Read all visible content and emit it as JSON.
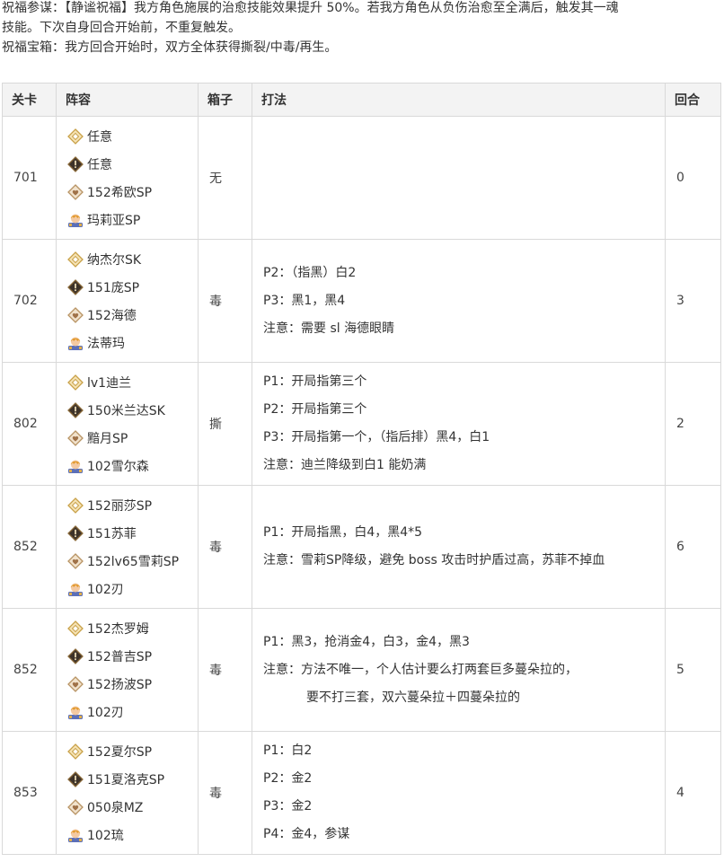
{
  "intro": {
    "line1": "祝福参谋：【静谧祝福】我方角色施展的治愈技能效果提升 50%。若我方角色从负伤治愈至全满后，触发其一魂",
    "line2": "技能。下次自身回合开始前，不重复触发。",
    "line3": "祝福宝箱：我方回合开始时，双方全体获得撕裂/中毒/再生。"
  },
  "headers": {
    "stage": "关卡",
    "lineup": "阵容",
    "box": "箱子",
    "strategy": "打法",
    "rounds": "回合"
  },
  "icons": {
    "slot1": "gold-diamond-icon",
    "slot2": "dark-diamond-icon",
    "slot3": "heart-diamond-icon",
    "slot4": "character-icon"
  },
  "rows": [
    {
      "stage": "701",
      "units": [
        "任意",
        "任意",
        "152希欧SP",
        "玛莉亚SP"
      ],
      "box": "无",
      "notes": [],
      "rounds": "0"
    },
    {
      "stage": "702",
      "units": [
        "纳杰尔SK",
        "151庞SP",
        "152海德",
        "法蒂玛"
      ],
      "box": "毒",
      "notes": [
        "P2：（指黑）白2",
        "P3：黑1，黑4",
        "注意：需要 sl 海德眼睛"
      ],
      "rounds": "3"
    },
    {
      "stage": "802",
      "units": [
        "lv1迪兰",
        "150米兰达SK",
        "黯月SP",
        "102雪尔森"
      ],
      "box": "撕",
      "notes": [
        "P1：开局指第三个",
        "P2：开局指第三个",
        "P3：开局指第一个，（指后排）黑4，白1",
        "注意：迪兰降级到白1 能奶满"
      ],
      "rounds": "2"
    },
    {
      "stage": "852",
      "units": [
        "152丽莎SP",
        "151苏菲",
        "152lv65雪莉SP",
        "102刃"
      ],
      "box": "毒",
      "notes": [
        "P1：开局指黑，白4，黑4*5",
        "注意：雪莉SP降级，避免 boss 攻击时护盾过高，苏菲不掉血"
      ],
      "rounds": "6"
    },
    {
      "stage": "852",
      "units": [
        "152杰罗姆",
        "152普吉SP",
        "152扬波SP",
        "102刃"
      ],
      "box": "毒",
      "notes": [
        "P1：黑3，抢消金4，白3，金4，黑3",
        "注意：方法不唯一，个人估计要么打两套巨多蔓朵拉的，",
        "要不打三套，双六蔓朵拉＋四蔓朵拉的"
      ],
      "rounds": "5"
    },
    {
      "stage": "853",
      "units": [
        "152夏尔SP",
        "151夏洛克SP",
        "050泉MZ",
        "102琉"
      ],
      "box": "毒",
      "notes": [
        "P1：白2",
        "P2：金2",
        "P3：金2",
        "P4：金4，参谋"
      ],
      "rounds": "4"
    }
  ]
}
